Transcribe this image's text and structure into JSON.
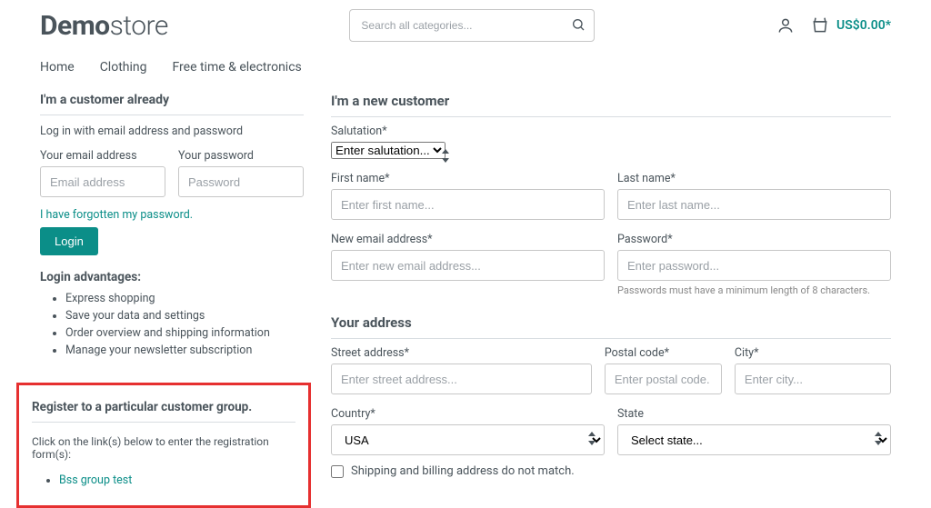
{
  "header": {
    "logo_bold": "Demo",
    "logo_light": "store",
    "search_placeholder": "Search all categories...",
    "cart_total": "US$0.00*"
  },
  "nav": {
    "home": "Home",
    "clothing": "Clothing",
    "freetime": "Free time & electronics"
  },
  "login": {
    "title": "I'm a customer already",
    "sub": "Log in with email address and password",
    "email_label": "Your email address",
    "email_placeholder": "Email address",
    "password_label": "Your password",
    "password_placeholder": "Password",
    "forgot": "I have forgotten my password.",
    "button": "Login",
    "adv_title": "Login advantages:",
    "adv1": "Express shopping",
    "adv2": "Save your data and settings",
    "adv3": "Order overview and shipping information",
    "adv4": "Manage your newsletter subscription"
  },
  "groupreg": {
    "title": "Register to a particular customer group.",
    "sub": "Click on the link(s) below to enter the registration form(s):",
    "link1": "Bss group test"
  },
  "register": {
    "title": "I'm a new customer",
    "salutation_label": "Salutation*",
    "salutation_placeholder": "Enter salutation...",
    "firstname_label": "First name*",
    "firstname_placeholder": "Enter first name...",
    "lastname_label": "Last name*",
    "lastname_placeholder": "Enter last name...",
    "email_label": "New email address*",
    "email_placeholder": "Enter new email address...",
    "password_label": "Password*",
    "password_placeholder": "Enter password...",
    "password_hint": "Passwords must have a minimum length of 8 characters.",
    "address_title": "Your address",
    "street_label": "Street address*",
    "street_placeholder": "Enter street address...",
    "postal_label": "Postal code*",
    "postal_placeholder": "Enter postal code.",
    "city_label": "City*",
    "city_placeholder": "Enter city...",
    "country_label": "Country*",
    "country_value": "USA",
    "state_label": "State",
    "state_placeholder": "Select state...",
    "different_shipping": "Shipping and billing address do not match."
  }
}
